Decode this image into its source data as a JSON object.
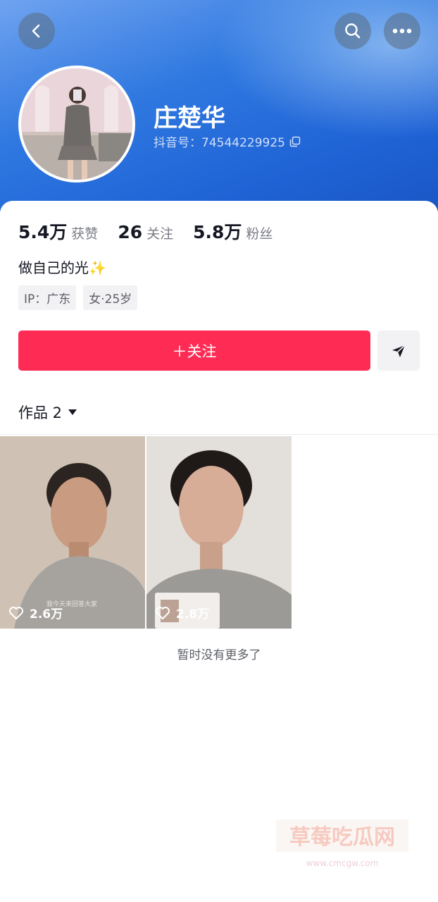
{
  "colors": {
    "accent": "#fe2c55",
    "header": "#2f78e0"
  },
  "header": {
    "back_icon": "chevron-left-icon",
    "search_icon": "search-icon",
    "more_icon": "more-horizontal-icon"
  },
  "profile": {
    "nickname": "庄楚华",
    "douyin_id": "抖音号：74544229925",
    "copy_icon": "copy-icon"
  },
  "stats": [
    {
      "value": "5.4万",
      "label": "获赞"
    },
    {
      "value": "26",
      "label": "关注"
    },
    {
      "value": "5.8万",
      "label": "粉丝"
    }
  ],
  "bio": "做自己的光✨",
  "tags": [
    "IP：广东",
    "女·25岁"
  ],
  "actions": {
    "follow_label": "＋关注",
    "share_icon": "send-icon"
  },
  "works": {
    "tab_label": "作品 2",
    "items": [
      {
        "likes": "2.6万",
        "caption": "我今天来回答大家"
      },
      {
        "likes": "2.8万"
      }
    ],
    "end_text": "暂时没有更多了"
  },
  "watermark": {
    "title": "草莓吃瓜网",
    "url": "www.cmcgw.com"
  }
}
